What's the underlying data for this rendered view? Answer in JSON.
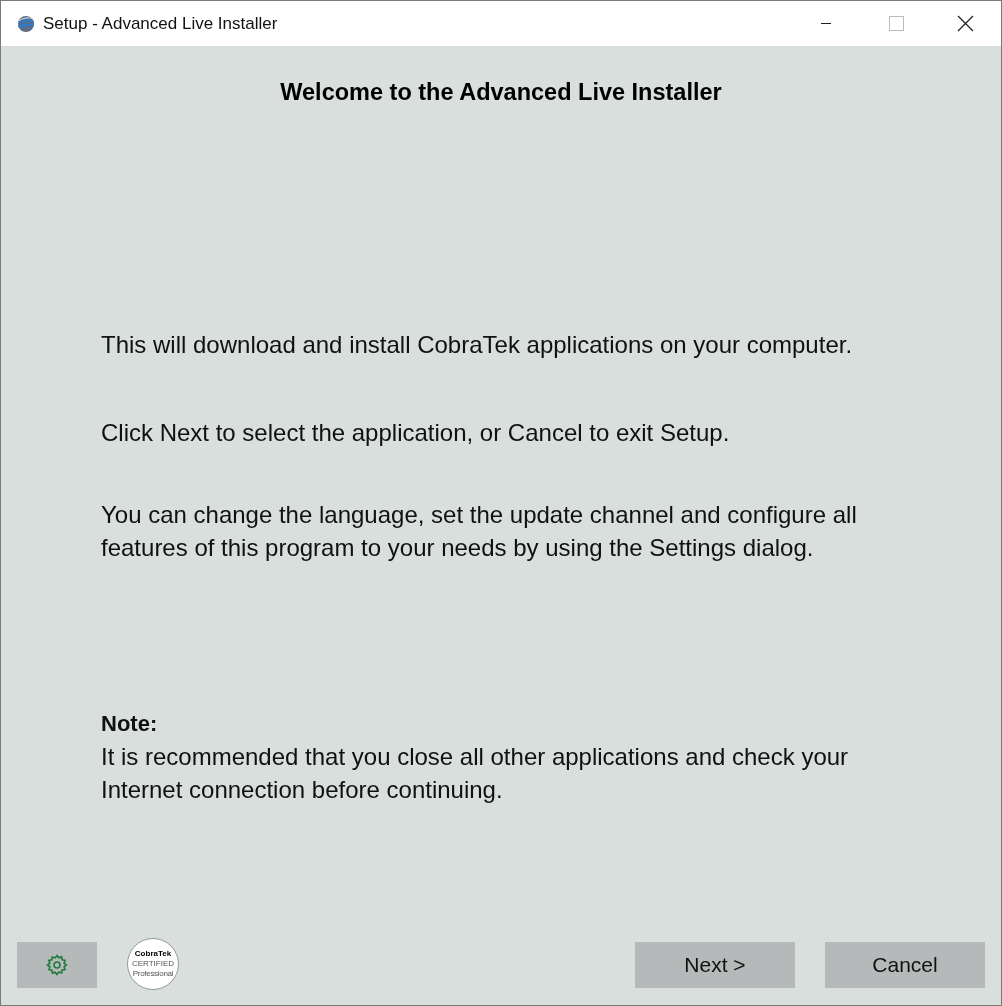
{
  "window": {
    "title": "Setup - Advanced Live Installer"
  },
  "heading": "Welcome to the Advanced Live Installer",
  "paragraphs": [
    "This will download and install CobraTek applications on your computer.",
    "Click Next to select the application, or Cancel to exit Setup.",
    "You can change the language, set the update channel and configure all features of this program to your needs by using the Settings dialog."
  ],
  "note": {
    "title": "Note:",
    "text": "It is recommended that you close all other applications and check your Internet connection before continuing."
  },
  "badge": [
    "CobraTek",
    "CERTIFIED",
    "Professional"
  ],
  "buttons": [
    "Next >",
    "Cancel"
  ]
}
